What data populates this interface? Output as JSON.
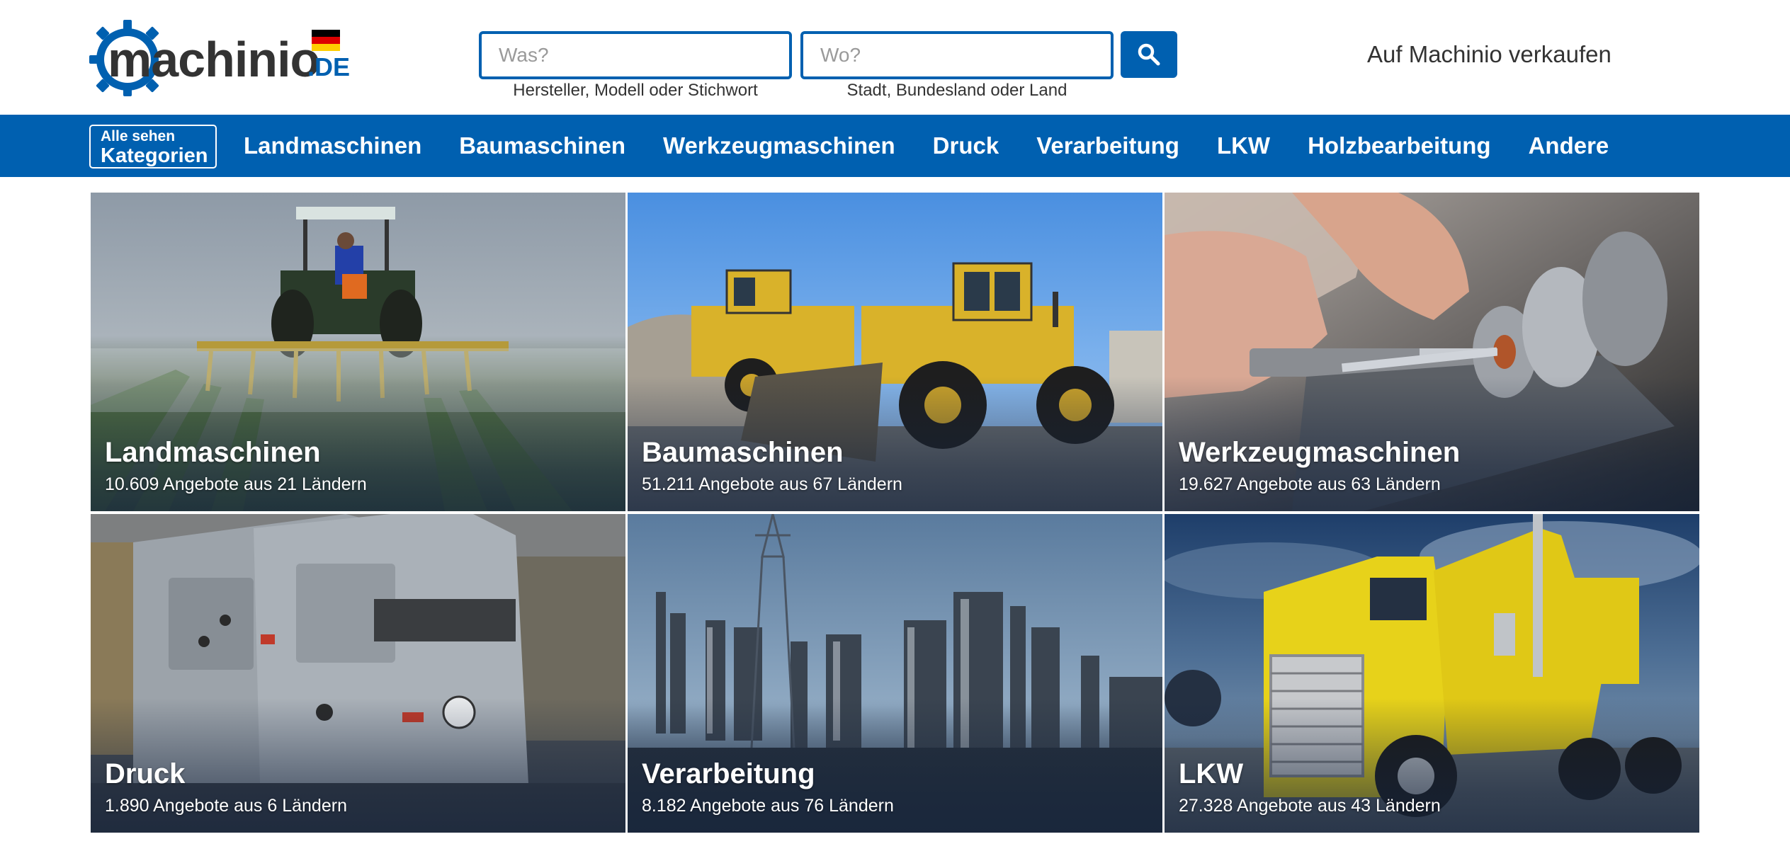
{
  "header": {
    "logo_text": "machinio",
    "logo_tld": ".DE",
    "search_what_placeholder": "Was?",
    "search_what_hint": "Hersteller, Modell oder Stichwort",
    "search_where_placeholder": "Wo?",
    "search_where_hint": "Stadt, Bundesland oder Land",
    "sell_link": "Auf Machinio verkaufen"
  },
  "nav": {
    "all_label_small": "Alle sehen",
    "all_label_big": "Kategorien",
    "items": [
      {
        "label": "Landmaschinen"
      },
      {
        "label": "Baumaschinen"
      },
      {
        "label": "Werkzeugmaschinen"
      },
      {
        "label": "Druck"
      },
      {
        "label": "Verarbeitung"
      },
      {
        "label": "LKW"
      },
      {
        "label": "Holzbearbeitung"
      },
      {
        "label": "Andere"
      }
    ]
  },
  "tiles": [
    {
      "title": "Landmaschinen",
      "subtitle": "10.609 Angebote aus 21 Ländern"
    },
    {
      "title": "Baumaschinen",
      "subtitle": "51.211 Angebote aus 67 Ländern"
    },
    {
      "title": "Werkzeugmaschinen",
      "subtitle": "19.627 Angebote aus 63 Ländern"
    },
    {
      "title": "Druck",
      "subtitle": "1.890 Angebote aus 6 Ländern"
    },
    {
      "title": "Verarbeitung",
      "subtitle": "8.182 Angebote aus 76 Ländern"
    },
    {
      "title": "LKW",
      "subtitle": "27.328 Angebote aus 43 Ländern"
    }
  ],
  "colors": {
    "brand_blue": "#0060b0",
    "flag": [
      "#000000",
      "#dd0000",
      "#ffce00"
    ]
  },
  "icons": {
    "search": "search-icon",
    "logo_gear": "gear-icon"
  }
}
